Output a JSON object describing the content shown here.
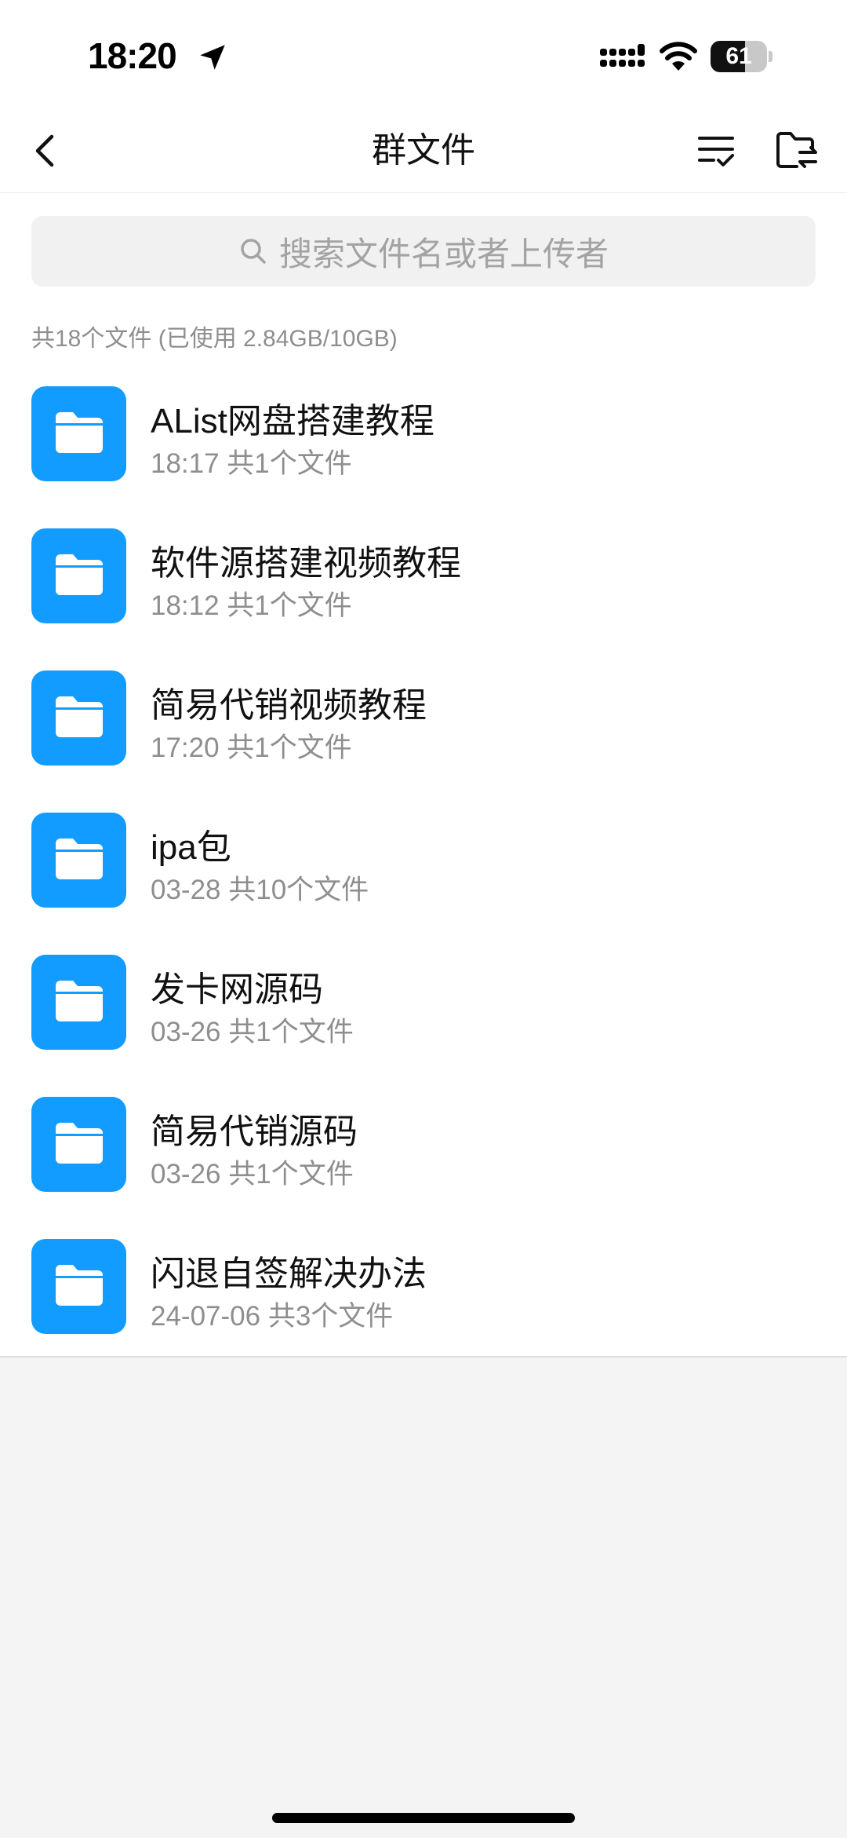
{
  "status_bar": {
    "time": "18:20",
    "battery_level": "61",
    "battery_fraction": 0.61
  },
  "nav": {
    "title": "群文件"
  },
  "search": {
    "placeholder": "搜索文件名或者上传者"
  },
  "summary": "共18个文件 (已使用 2.84GB/10GB)",
  "colors": {
    "folder_accent": "#129cff",
    "meta_text": "#8e8e8e"
  },
  "folders": [
    {
      "name": "AList网盘搭建教程",
      "meta": "18:17 共1个文件",
      "icon": "folder-icon"
    },
    {
      "name": "软件源搭建视频教程",
      "meta": "18:12 共1个文件",
      "icon": "folder-icon"
    },
    {
      "name": "简易代销视频教程",
      "meta": "17:20 共1个文件",
      "icon": "folder-icon"
    },
    {
      "name": "ipa包",
      "meta": "03-28 共10个文件",
      "icon": "folder-icon"
    },
    {
      "name": "发卡网源码",
      "meta": "03-26 共1个文件",
      "icon": "folder-icon"
    },
    {
      "name": "简易代销源码",
      "meta": "03-26 共1个文件",
      "icon": "folder-icon"
    },
    {
      "name": "闪退自签解决办法",
      "meta": "24-07-06 共3个文件",
      "icon": "folder-icon"
    }
  ]
}
